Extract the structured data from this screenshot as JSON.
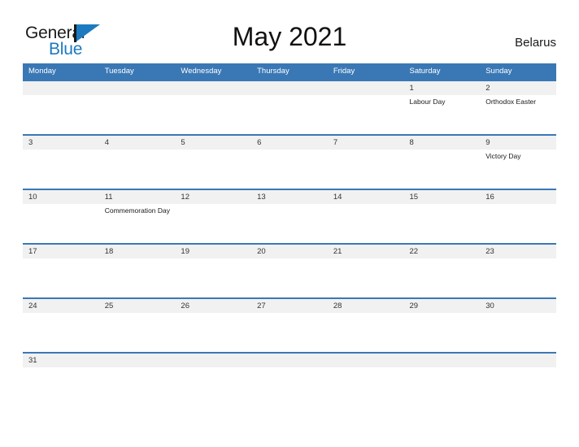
{
  "header": {
    "logo": {
      "word1": "General",
      "word2": "Blue",
      "flag_icon": "flag-triangle-icon"
    },
    "title": "May 2021",
    "country": "Belarus"
  },
  "colors": {
    "header_blue": "#3a78b5",
    "row_line_blue": "#3a78b5",
    "daynum_band_gray": "#f1f1f1",
    "logo_blue": "#1c7ac0",
    "text_dark": "#1a1a1a"
  },
  "calendar": {
    "weekdays": [
      "Monday",
      "Tuesday",
      "Wednesday",
      "Thursday",
      "Friday",
      "Saturday",
      "Sunday"
    ],
    "weeks": [
      {
        "days": [
          {
            "num": "",
            "event": ""
          },
          {
            "num": "",
            "event": ""
          },
          {
            "num": "",
            "event": ""
          },
          {
            "num": "",
            "event": ""
          },
          {
            "num": "",
            "event": ""
          },
          {
            "num": "1",
            "event": "Labour Day"
          },
          {
            "num": "2",
            "event": "Orthodox Easter"
          }
        ]
      },
      {
        "days": [
          {
            "num": "3",
            "event": ""
          },
          {
            "num": "4",
            "event": ""
          },
          {
            "num": "5",
            "event": ""
          },
          {
            "num": "6",
            "event": ""
          },
          {
            "num": "7",
            "event": ""
          },
          {
            "num": "8",
            "event": ""
          },
          {
            "num": "9",
            "event": "Victory Day"
          }
        ]
      },
      {
        "days": [
          {
            "num": "10",
            "event": ""
          },
          {
            "num": "11",
            "event": "Commemoration Day"
          },
          {
            "num": "12",
            "event": ""
          },
          {
            "num": "13",
            "event": ""
          },
          {
            "num": "14",
            "event": ""
          },
          {
            "num": "15",
            "event": ""
          },
          {
            "num": "16",
            "event": ""
          }
        ]
      },
      {
        "days": [
          {
            "num": "17",
            "event": ""
          },
          {
            "num": "18",
            "event": ""
          },
          {
            "num": "19",
            "event": ""
          },
          {
            "num": "20",
            "event": ""
          },
          {
            "num": "21",
            "event": ""
          },
          {
            "num": "22",
            "event": ""
          },
          {
            "num": "23",
            "event": ""
          }
        ]
      },
      {
        "days": [
          {
            "num": "24",
            "event": ""
          },
          {
            "num": "25",
            "event": ""
          },
          {
            "num": "26",
            "event": ""
          },
          {
            "num": "27",
            "event": ""
          },
          {
            "num": "28",
            "event": ""
          },
          {
            "num": "29",
            "event": ""
          },
          {
            "num": "30",
            "event": ""
          }
        ]
      },
      {
        "last": true,
        "days": [
          {
            "num": "31",
            "event": ""
          },
          {
            "num": "",
            "event": ""
          },
          {
            "num": "",
            "event": ""
          },
          {
            "num": "",
            "event": ""
          },
          {
            "num": "",
            "event": ""
          },
          {
            "num": "",
            "event": ""
          },
          {
            "num": "",
            "event": ""
          }
        ]
      }
    ]
  }
}
